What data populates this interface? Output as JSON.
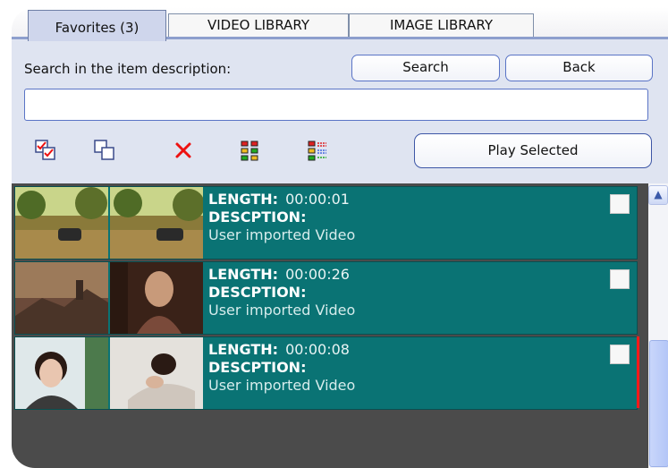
{
  "tabs": [
    {
      "label": "Favorites (3)",
      "active": true
    },
    {
      "label": "VIDEO LIBRARY",
      "active": false
    },
    {
      "label": "IMAGE LIBRARY",
      "active": false
    }
  ],
  "search": {
    "label": "Search in the item description:",
    "value": "",
    "search_button": "Search",
    "back_button": "Back"
  },
  "toolbar": {
    "icons": [
      "select-all-icon",
      "deselect-icon",
      "delete-icon",
      "grid-view-icon",
      "list-view-icon"
    ],
    "play_selected": "Play Selected"
  },
  "items": [
    {
      "length_label": "LENGTH:",
      "length": "00:00:01",
      "desc_label": "DESCPTION:",
      "description": "User imported Video",
      "checked": false
    },
    {
      "length_label": "LENGTH:",
      "length": "00:00:26",
      "desc_label": "DESCPTION:",
      "description": "User imported Video",
      "checked": false
    },
    {
      "length_label": "LENGTH:",
      "length": "00:00:08",
      "desc_label": "DESCPTION:",
      "description": "User imported Video",
      "checked": false
    }
  ],
  "colors": {
    "item_bg": "#0a7374",
    "list_bg": "#4b4b4b",
    "accent": "#5a74c6",
    "highlight": "#ff1a1a"
  }
}
